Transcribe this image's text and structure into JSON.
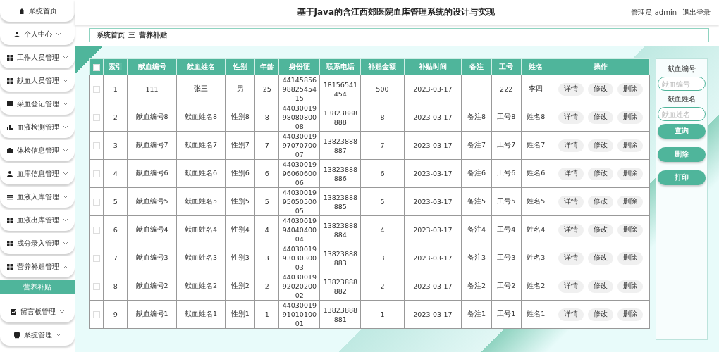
{
  "sidebar": {
    "items": [
      {
        "label": "系统首页",
        "kind": "link"
      },
      {
        "label": "个人中心",
        "kind": "menu",
        "expanded": false
      },
      {
        "label": "工作人员管理",
        "kind": "menu",
        "expanded": false
      },
      {
        "label": "献血人员管理",
        "kind": "menu",
        "expanded": false
      },
      {
        "label": "采血登记管理",
        "kind": "menu",
        "expanded": false
      },
      {
        "label": "血液检测管理",
        "kind": "menu",
        "expanded": false
      },
      {
        "label": "体检信息管理",
        "kind": "menu",
        "expanded": false
      },
      {
        "label": "血库信息管理",
        "kind": "menu",
        "expanded": false
      },
      {
        "label": "血液入库管理",
        "kind": "menu",
        "expanded": false
      },
      {
        "label": "血液出库管理",
        "kind": "menu",
        "expanded": false
      },
      {
        "label": "成分录入管理",
        "kind": "menu",
        "expanded": false
      },
      {
        "label": "营养补贴管理",
        "kind": "menu",
        "expanded": true,
        "children": [
          {
            "label": "营养补贴",
            "selected": true
          }
        ]
      },
      {
        "label": "留言板管理",
        "kind": "menu",
        "expanded": false
      },
      {
        "label": "系统管理",
        "kind": "menu",
        "expanded": false
      }
    ]
  },
  "header": {
    "title": "基于Java的含江西郊医院血库管理系统的设计与实现",
    "user": "管理员 admin",
    "logout": "退出登录"
  },
  "breadcrumb": {
    "items": [
      "系统首页",
      "营养补贴"
    ],
    "separator": "三"
  },
  "table": {
    "columns": [
      "索引",
      "献血编号",
      "献血姓名",
      "性别",
      "年龄",
      "身份证",
      "联系电话",
      "补贴金额",
      "补贴时间",
      "备注",
      "工号",
      "姓名",
      "操作"
    ],
    "rows": [
      {
        "checked": false,
        "cells": [
          "1",
          "111",
          "张三",
          "男",
          "25",
          "441458569882545415",
          "18156541454",
          "500",
          "2023-03-17",
          null,
          "222",
          "李四"
        ],
        "actions": [
          "详情",
          "修改",
          "删除"
        ]
      },
      {
        "checked": false,
        "cells": [
          "2",
          "献血编号8",
          "献血姓名8",
          "性别8",
          "8",
          "440300199808080008",
          "13823888888",
          "8",
          "2023-03-17",
          "备注8",
          "工号8",
          "姓名8"
        ],
        "actions": [
          "详情",
          "修改",
          "删除"
        ]
      },
      {
        "checked": false,
        "cells": [
          "3",
          "献血编号7",
          "献血姓名7",
          "性别7",
          "7",
          "440300199707070007",
          "13823888887",
          "7",
          "2023-03-17",
          "备注7",
          "工号7",
          "姓名7"
        ],
        "actions": [
          "详情",
          "修改",
          "删除"
        ]
      },
      {
        "checked": false,
        "cells": [
          "4",
          "献血编号6",
          "献血姓名6",
          "性别6",
          "6",
          "440300199606060006",
          "13823888886",
          "6",
          "2023-03-17",
          "备注6",
          "工号6",
          "姓名6"
        ],
        "actions": [
          "详情",
          "修改",
          "删除"
        ]
      },
      {
        "checked": false,
        "cells": [
          "5",
          "献血编号5",
          "献血姓名5",
          "性别5",
          "5",
          "440300199505050005",
          "13823888885",
          "5",
          "2023-03-17",
          "备注5",
          "工号5",
          "姓名5"
        ],
        "actions": [
          "详情",
          "修改",
          "删除"
        ]
      },
      {
        "checked": false,
        "cells": [
          "6",
          "献血编号4",
          "献血姓名4",
          "性别4",
          "4",
          "440300199404040004",
          "13823888884",
          "4",
          "2023-03-17",
          "备注4",
          "工号4",
          "姓名4"
        ],
        "actions": [
          "详情",
          "修改",
          "删除"
        ]
      },
      {
        "checked": false,
        "cells": [
          "7",
          "献血编号3",
          "献血姓名3",
          "性别3",
          "3",
          "440300199303030003",
          "13823888883",
          "3",
          "2023-03-17",
          "备注3",
          "工号3",
          "姓名3"
        ],
        "actions": [
          "详情",
          "修改",
          "删除"
        ]
      },
      {
        "checked": false,
        "cells": [
          "8",
          "献血编号2",
          "献血姓名2",
          "性别2",
          "2",
          "440300199202020002",
          "13823888882",
          "2",
          "2023-03-17",
          "备注2",
          "工号2",
          "姓名2"
        ],
        "actions": [
          "详情",
          "修改",
          "删除"
        ]
      },
      {
        "checked": false,
        "cells": [
          "9",
          "献血编号1",
          "献血姓名1",
          "性别1",
          "1",
          "440300199101010001",
          "13823888881",
          "1",
          "2023-03-17",
          "备注1",
          "工号1",
          "姓名1"
        ],
        "actions": [
          "详情",
          "修改",
          "删除"
        ]
      }
    ]
  },
  "search_panel": {
    "fields": [
      {
        "label": "献血编号",
        "placeholder": "献血编号"
      },
      {
        "label": "献血姓名",
        "placeholder": "献血姓名"
      }
    ],
    "buttons": [
      "查询",
      "删除",
      "打印"
    ]
  }
}
